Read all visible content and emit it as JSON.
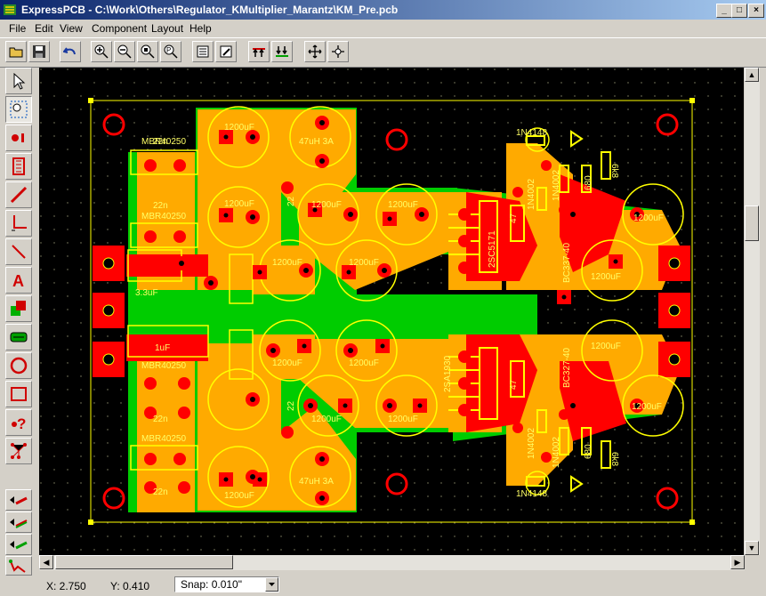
{
  "window": {
    "title": "ExpressPCB - C:\\Work\\Others\\Regulator_KMultiplier_Marantz\\KM_Pre.pcb",
    "minimize": "_",
    "maximize": "□",
    "close": "×"
  },
  "menu": [
    "File",
    "Edit",
    "View",
    "Component",
    "Layout",
    "Help"
  ],
  "status": {
    "x": "X: 2.750",
    "y": "Y: 0.410",
    "snap": "Snap:  0.010\""
  },
  "pcb_labels": {
    "c1200": "1200uF",
    "l47uh": "47uH 3A",
    "c22n": "22n",
    "mbr": "MBR40250",
    "c3u3": "3.3uF",
    "c1u": "1uF",
    "r22": "22",
    "d1n4148": "1N4148",
    "d1n4002": "1N4002",
    "r680": "680",
    "r6k8": "6k8",
    "r47": "47",
    "q2sc": "2SC5171",
    "q2sa": "2SA1930",
    "bc337": "BC337-40",
    "bc327": "BC327-40"
  },
  "colors": {
    "copper_top": "#ff0000",
    "copper_bottom": "#00cc00",
    "overlap": "#ffaa00",
    "silkscreen": "#ffff00",
    "board_bg": "#000000",
    "title_left": "#0a246a",
    "title_right": "#a6caf0"
  }
}
